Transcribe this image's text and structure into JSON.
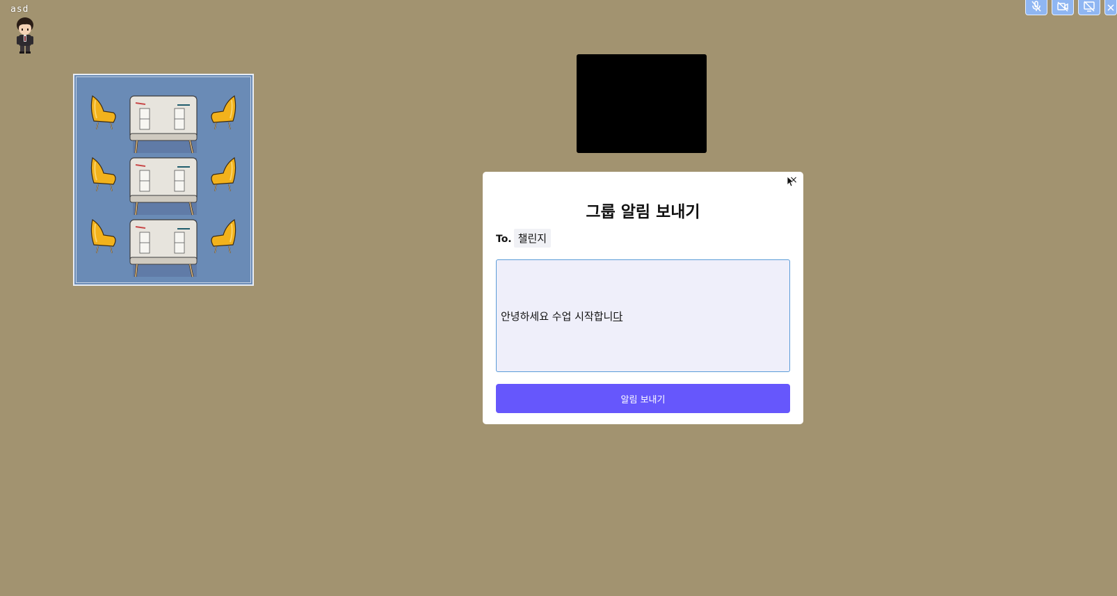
{
  "player": {
    "name": "asd"
  },
  "controls": [
    {
      "icon": "mic-off-icon"
    },
    {
      "icon": "camera-off-icon"
    },
    {
      "icon": "screen-share-off-icon"
    },
    {
      "icon": "close-icon"
    }
  ],
  "modal": {
    "title": "그룹 알림 보내기",
    "to_label": "To.",
    "recipient": "챌린지",
    "message_committed": "안녕하세요 수업 시작합니",
    "message_composing": "다",
    "send_label": "알림 보내기",
    "close_glyph": "×"
  },
  "colors": {
    "background": "#a29370",
    "classroom": "#6a8bb6",
    "accent": "#6657fc",
    "control_button": "#8fb6f2"
  }
}
